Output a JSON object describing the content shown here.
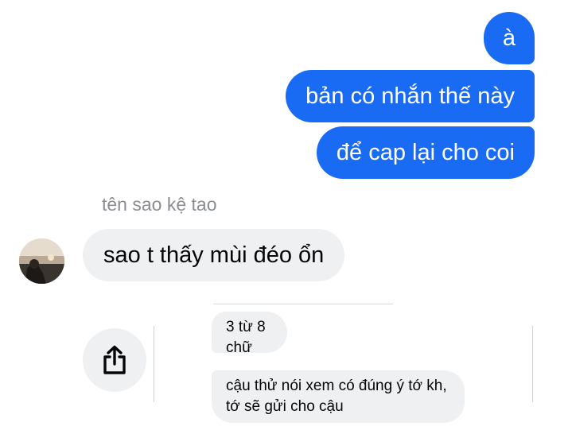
{
  "outgoing": [
    {
      "text": "à"
    },
    {
      "text": "bản có nhắn thế này"
    },
    {
      "text": "để cap lại cho coi"
    }
  ],
  "incoming": {
    "sender_name": "tên sao kệ tao",
    "text": "sao t thấy mùi đéo ổn"
  },
  "share_icon": "share-icon",
  "quoted": [
    {
      "text": "3 từ 8 chữ"
    },
    {
      "text": "cậu thử nói xem có đúng ý tớ kh, tớ sẽ gửi cho cậu"
    }
  ],
  "colors": {
    "outgoing_bubble": "#1a6bf3",
    "incoming_bubble": "#eff0f2",
    "sender_text": "#8a8d91"
  }
}
